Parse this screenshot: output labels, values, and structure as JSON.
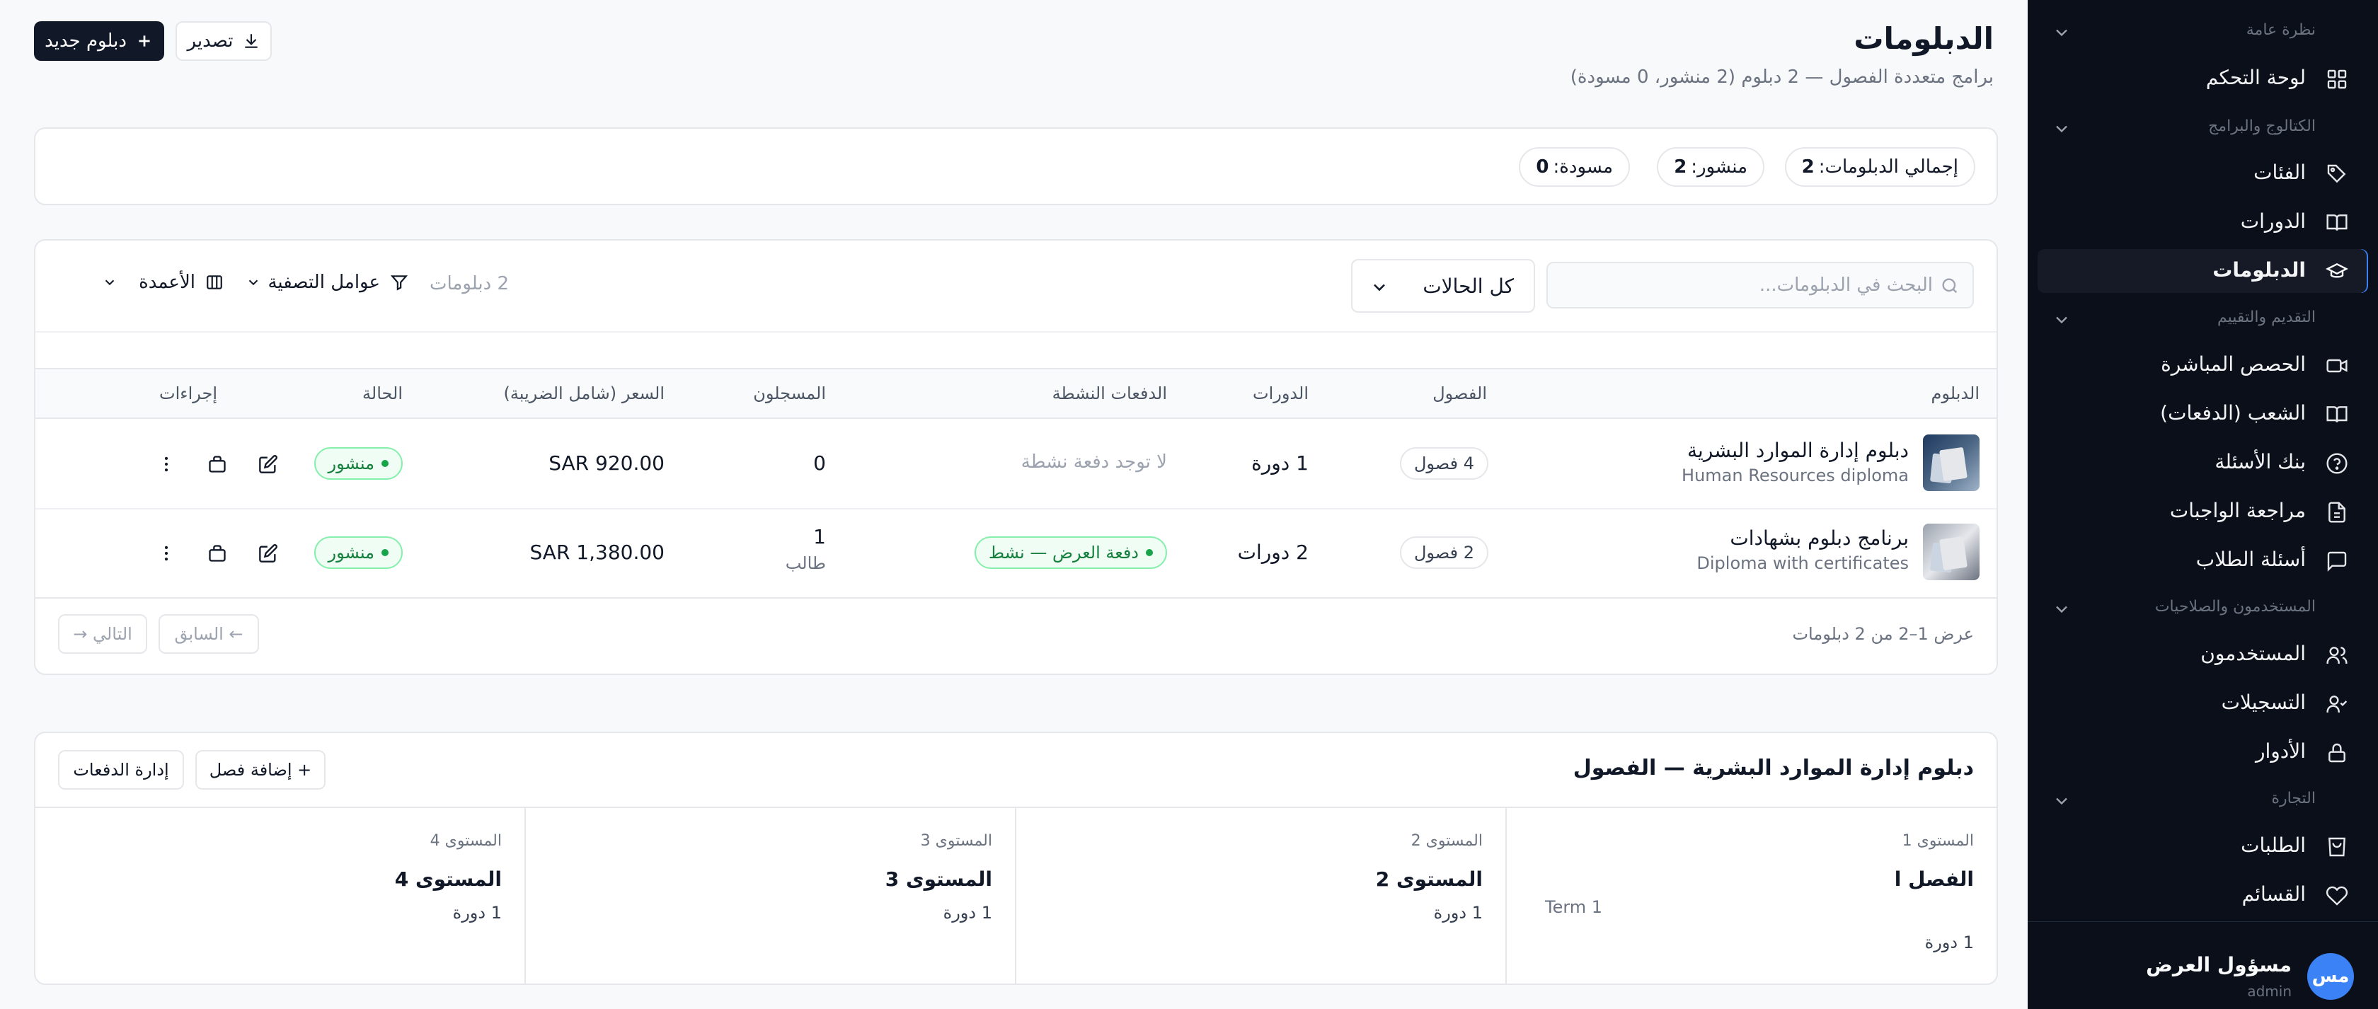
{
  "sidebar": {
    "sections": [
      {
        "label": "نظرة عامة"
      },
      {
        "label": "الكتالوج والبرامج"
      },
      {
        "label": "التقديم والتقييم"
      },
      {
        "label": "المستخدمون والصلاحيات"
      },
      {
        "label": "التجارة"
      }
    ],
    "items": [
      {
        "label": "لوحة التحكم",
        "icon": "dashboard-icon"
      },
      {
        "label": "الفئات",
        "icon": "tag-icon"
      },
      {
        "label": "الدورات",
        "icon": "book-icon"
      },
      {
        "label": "الدبلومات",
        "icon": "graduation-cap-icon",
        "active": true
      },
      {
        "label": "الحصص المباشرة",
        "icon": "video-icon"
      },
      {
        "label": "الشعب (الدفعات)",
        "icon": "book-open-icon"
      },
      {
        "label": "بنك الأسئلة",
        "icon": "question-icon"
      },
      {
        "label": "مراجعة الواجبات",
        "icon": "file-icon"
      },
      {
        "label": "أسئلة الطلاب",
        "icon": "message-icon"
      },
      {
        "label": "المستخدمون",
        "icon": "users-icon"
      },
      {
        "label": "التسجيلات",
        "icon": "user-check-icon"
      },
      {
        "label": "الأدوار",
        "icon": "lock-icon"
      },
      {
        "label": "الطلبات",
        "icon": "shopping-bag-icon"
      },
      {
        "label": "القسائم",
        "icon": "heart-icon"
      }
    ],
    "user": {
      "avatar": "مس",
      "name": "مسؤول العرض",
      "role": "admin"
    }
  },
  "header": {
    "title": "الدبلومات",
    "subtitle": "برامج متعددة الفصول — 2 دبلوم (2 منشور، 0 مسودة)",
    "new_button": "دبلوم جديد",
    "export_button": "تصدير"
  },
  "stats": {
    "total_label": "إجمالي الدبلومات:",
    "total": "2",
    "published_label": "منشور:",
    "published": "2",
    "draft_label": "مسودة:",
    "draft": "0"
  },
  "toolbar": {
    "search_placeholder": "البحث في الدبلومات...",
    "status_select": "كل الحالات",
    "count": "2 دبلومات",
    "filters": "عوامل التصفية",
    "columns": "الأعمدة"
  },
  "table": {
    "headers": [
      "الدبلوم",
      "الفصول",
      "الدورات",
      "الدفعات النشطة",
      "المسجلون",
      "السعر (شامل الضريبة)",
      "الحالة",
      "إجراءات"
    ],
    "rows": [
      {
        "title": "دبلوم إدارة الموارد البشرية",
        "subtitle": "Human Resources diploma",
        "terms": "4 فصول",
        "courses": "1 دورة",
        "batches": "لا توجد دفعة نشطة",
        "enrolled": "0",
        "enrolled_unit": "",
        "price": "SAR 920.00",
        "status": "منشور"
      },
      {
        "title": "برنامج دبلوم بشهادات",
        "subtitle": "Diploma with certificates",
        "terms": "2 فصول",
        "courses": "2 دورات",
        "batches": "دفعة العرض — نشط",
        "enrolled": "1",
        "enrolled_unit": "طالب",
        "price": "SAR 1,380.00",
        "status": "منشور"
      }
    ]
  },
  "pagination": {
    "info": "عرض 1–2 من 2 دبلومات",
    "prev": "← السابق",
    "next": "التالي →"
  },
  "terms_panel": {
    "title": "دبلوم إدارة الموارد البشرية — الفصول",
    "add_term": "+ إضافة فصل",
    "manage_batches": "إدارة الدفعات",
    "terms": [
      {
        "level": "المستوى 1",
        "name": "الفصل ا",
        "alt": "Term 1",
        "courses": "1 دورة"
      },
      {
        "level": "المستوى 2",
        "name": "المستوى 2",
        "alt": "",
        "courses": "1 دورة"
      },
      {
        "level": "المستوى 3",
        "name": "المستوى 3",
        "alt": "",
        "courses": "1 دورة"
      },
      {
        "level": "المستوى 4",
        "name": "المستوى 4",
        "alt": "",
        "courses": "1 دورة"
      }
    ]
  },
  "colors": {
    "sidebar_bg": "#0b0f19",
    "primary": "#111827",
    "success": "#16a34a",
    "accent": "#3b82f6"
  }
}
